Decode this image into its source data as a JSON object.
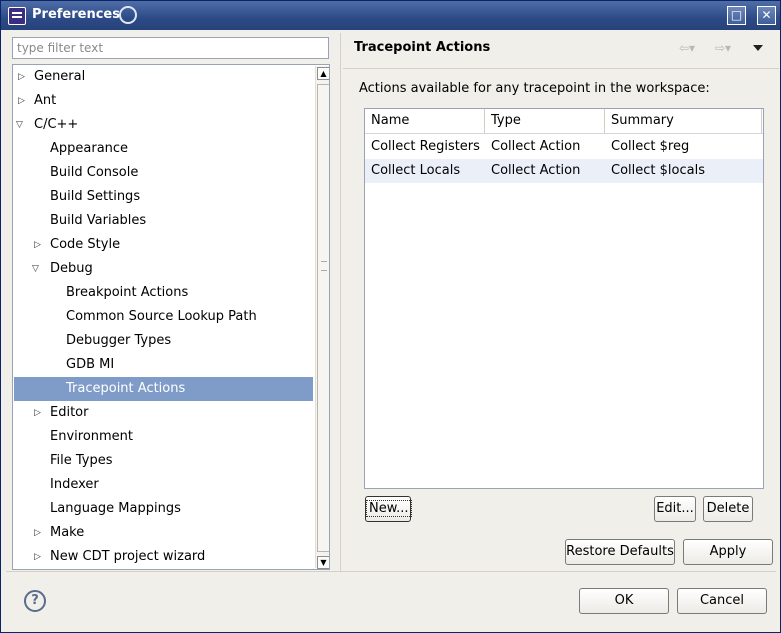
{
  "window": {
    "title": "Preferences",
    "maximize_glyph": "□",
    "close_glyph": "✕"
  },
  "filter": {
    "placeholder": "type filter text",
    "value": ""
  },
  "tree": {
    "items": [
      {
        "label": "General",
        "expander": "▷"
      },
      {
        "label": "Ant",
        "expander": "▷"
      },
      {
        "label": "C/C++",
        "expander": "▽"
      },
      {
        "label": "Appearance",
        "expander": ""
      },
      {
        "label": "Build Console",
        "expander": ""
      },
      {
        "label": "Build Settings",
        "expander": ""
      },
      {
        "label": "Build Variables",
        "expander": ""
      },
      {
        "label": "Code Style",
        "expander": "▷"
      },
      {
        "label": "Debug",
        "expander": "▽"
      },
      {
        "label": "Breakpoint Actions",
        "expander": ""
      },
      {
        "label": "Common Source Lookup Path",
        "expander": ""
      },
      {
        "label": "Debugger Types",
        "expander": ""
      },
      {
        "label": "GDB MI",
        "expander": ""
      },
      {
        "label": "Tracepoint Actions",
        "expander": ""
      },
      {
        "label": "Editor",
        "expander": "▷"
      },
      {
        "label": "Environment",
        "expander": ""
      },
      {
        "label": "File Types",
        "expander": ""
      },
      {
        "label": "Indexer",
        "expander": ""
      },
      {
        "label": "Language Mappings",
        "expander": ""
      },
      {
        "label": "Make",
        "expander": "▷"
      },
      {
        "label": "New CDT project wizard",
        "expander": "▷"
      }
    ],
    "selected": "Tracepoint Actions"
  },
  "page": {
    "title": "Tracepoint Actions",
    "back_glyph": "⇦▾",
    "forward_glyph": "⇨▾",
    "description": "Actions available for any tracepoint in the workspace:"
  },
  "actions_table": {
    "columns": [
      "Name",
      "Type",
      "Summary"
    ],
    "rows": [
      {
        "name": "Collect Registers",
        "type": "Collect Action",
        "summary": "Collect $reg"
      },
      {
        "name": "Collect Locals",
        "type": "Collect Action",
        "summary": "Collect $locals"
      }
    ]
  },
  "buttons": {
    "new": "New...",
    "edit": "Edit...",
    "delete": "Delete",
    "restore_defaults": "Restore Defaults",
    "apply": "Apply",
    "ok": "OK",
    "cancel": "Cancel",
    "help": "?"
  },
  "colors": {
    "title_bar": "#2c4a86",
    "selection": "#7f9cc8",
    "alt_row": "#eaeff8"
  }
}
